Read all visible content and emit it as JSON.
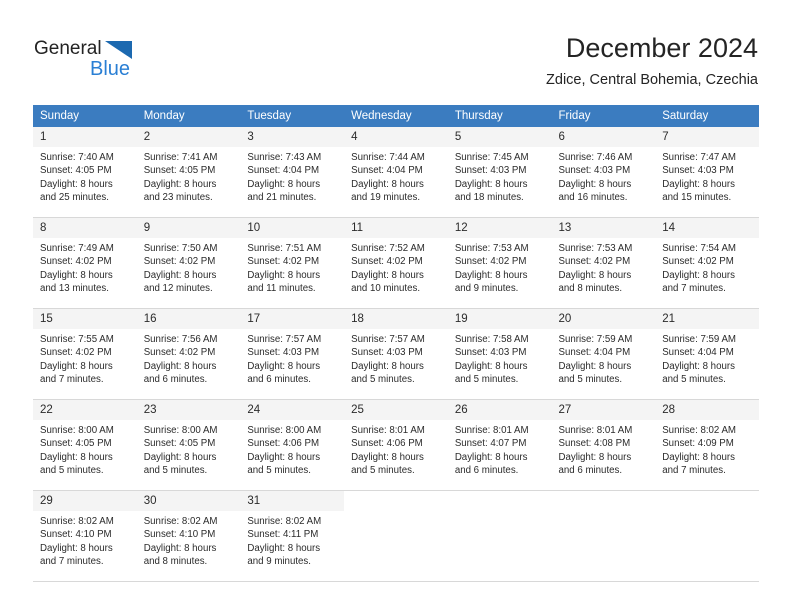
{
  "brand": {
    "name_part1": "General",
    "name_part2": "Blue",
    "accent_color": "#2a7fd4",
    "triangle_color": "#1c69b0"
  },
  "header": {
    "title": "December 2024",
    "subtitle": "Zdice, Central Bohemia, Czechia"
  },
  "calendar": {
    "header_bg": "#3b7cc0",
    "weekday_headers": [
      "Sunday",
      "Monday",
      "Tuesday",
      "Wednesday",
      "Thursday",
      "Friday",
      "Saturday"
    ],
    "weeks": [
      [
        {
          "day": "1",
          "sunrise": "Sunrise: 7:40 AM",
          "sunset": "Sunset: 4:05 PM",
          "daylight_line1": "Daylight: 8 hours",
          "daylight_line2": "and 25 minutes."
        },
        {
          "day": "2",
          "sunrise": "Sunrise: 7:41 AM",
          "sunset": "Sunset: 4:05 PM",
          "daylight_line1": "Daylight: 8 hours",
          "daylight_line2": "and 23 minutes."
        },
        {
          "day": "3",
          "sunrise": "Sunrise: 7:43 AM",
          "sunset": "Sunset: 4:04 PM",
          "daylight_line1": "Daylight: 8 hours",
          "daylight_line2": "and 21 minutes."
        },
        {
          "day": "4",
          "sunrise": "Sunrise: 7:44 AM",
          "sunset": "Sunset: 4:04 PM",
          "daylight_line1": "Daylight: 8 hours",
          "daylight_line2": "and 19 minutes."
        },
        {
          "day": "5",
          "sunrise": "Sunrise: 7:45 AM",
          "sunset": "Sunset: 4:03 PM",
          "daylight_line1": "Daylight: 8 hours",
          "daylight_line2": "and 18 minutes."
        },
        {
          "day": "6",
          "sunrise": "Sunrise: 7:46 AM",
          "sunset": "Sunset: 4:03 PM",
          "daylight_line1": "Daylight: 8 hours",
          "daylight_line2": "and 16 minutes."
        },
        {
          "day": "7",
          "sunrise": "Sunrise: 7:47 AM",
          "sunset": "Sunset: 4:03 PM",
          "daylight_line1": "Daylight: 8 hours",
          "daylight_line2": "and 15 minutes."
        }
      ],
      [
        {
          "day": "8",
          "sunrise": "Sunrise: 7:49 AM",
          "sunset": "Sunset: 4:02 PM",
          "daylight_line1": "Daylight: 8 hours",
          "daylight_line2": "and 13 minutes."
        },
        {
          "day": "9",
          "sunrise": "Sunrise: 7:50 AM",
          "sunset": "Sunset: 4:02 PM",
          "daylight_line1": "Daylight: 8 hours",
          "daylight_line2": "and 12 minutes."
        },
        {
          "day": "10",
          "sunrise": "Sunrise: 7:51 AM",
          "sunset": "Sunset: 4:02 PM",
          "daylight_line1": "Daylight: 8 hours",
          "daylight_line2": "and 11 minutes."
        },
        {
          "day": "11",
          "sunrise": "Sunrise: 7:52 AM",
          "sunset": "Sunset: 4:02 PM",
          "daylight_line1": "Daylight: 8 hours",
          "daylight_line2": "and 10 minutes."
        },
        {
          "day": "12",
          "sunrise": "Sunrise: 7:53 AM",
          "sunset": "Sunset: 4:02 PM",
          "daylight_line1": "Daylight: 8 hours",
          "daylight_line2": "and 9 minutes."
        },
        {
          "day": "13",
          "sunrise": "Sunrise: 7:53 AM",
          "sunset": "Sunset: 4:02 PM",
          "daylight_line1": "Daylight: 8 hours",
          "daylight_line2": "and 8 minutes."
        },
        {
          "day": "14",
          "sunrise": "Sunrise: 7:54 AM",
          "sunset": "Sunset: 4:02 PM",
          "daylight_line1": "Daylight: 8 hours",
          "daylight_line2": "and 7 minutes."
        }
      ],
      [
        {
          "day": "15",
          "sunrise": "Sunrise: 7:55 AM",
          "sunset": "Sunset: 4:02 PM",
          "daylight_line1": "Daylight: 8 hours",
          "daylight_line2": "and 7 minutes."
        },
        {
          "day": "16",
          "sunrise": "Sunrise: 7:56 AM",
          "sunset": "Sunset: 4:02 PM",
          "daylight_line1": "Daylight: 8 hours",
          "daylight_line2": "and 6 minutes."
        },
        {
          "day": "17",
          "sunrise": "Sunrise: 7:57 AM",
          "sunset": "Sunset: 4:03 PM",
          "daylight_line1": "Daylight: 8 hours",
          "daylight_line2": "and 6 minutes."
        },
        {
          "day": "18",
          "sunrise": "Sunrise: 7:57 AM",
          "sunset": "Sunset: 4:03 PM",
          "daylight_line1": "Daylight: 8 hours",
          "daylight_line2": "and 5 minutes."
        },
        {
          "day": "19",
          "sunrise": "Sunrise: 7:58 AM",
          "sunset": "Sunset: 4:03 PM",
          "daylight_line1": "Daylight: 8 hours",
          "daylight_line2": "and 5 minutes."
        },
        {
          "day": "20",
          "sunrise": "Sunrise: 7:59 AM",
          "sunset": "Sunset: 4:04 PM",
          "daylight_line1": "Daylight: 8 hours",
          "daylight_line2": "and 5 minutes."
        },
        {
          "day": "21",
          "sunrise": "Sunrise: 7:59 AM",
          "sunset": "Sunset: 4:04 PM",
          "daylight_line1": "Daylight: 8 hours",
          "daylight_line2": "and 5 minutes."
        }
      ],
      [
        {
          "day": "22",
          "sunrise": "Sunrise: 8:00 AM",
          "sunset": "Sunset: 4:05 PM",
          "daylight_line1": "Daylight: 8 hours",
          "daylight_line2": "and 5 minutes."
        },
        {
          "day": "23",
          "sunrise": "Sunrise: 8:00 AM",
          "sunset": "Sunset: 4:05 PM",
          "daylight_line1": "Daylight: 8 hours",
          "daylight_line2": "and 5 minutes."
        },
        {
          "day": "24",
          "sunrise": "Sunrise: 8:00 AM",
          "sunset": "Sunset: 4:06 PM",
          "daylight_line1": "Daylight: 8 hours",
          "daylight_line2": "and 5 minutes."
        },
        {
          "day": "25",
          "sunrise": "Sunrise: 8:01 AM",
          "sunset": "Sunset: 4:06 PM",
          "daylight_line1": "Daylight: 8 hours",
          "daylight_line2": "and 5 minutes."
        },
        {
          "day": "26",
          "sunrise": "Sunrise: 8:01 AM",
          "sunset": "Sunset: 4:07 PM",
          "daylight_line1": "Daylight: 8 hours",
          "daylight_line2": "and 6 minutes."
        },
        {
          "day": "27",
          "sunrise": "Sunrise: 8:01 AM",
          "sunset": "Sunset: 4:08 PM",
          "daylight_line1": "Daylight: 8 hours",
          "daylight_line2": "and 6 minutes."
        },
        {
          "day": "28",
          "sunrise": "Sunrise: 8:02 AM",
          "sunset": "Sunset: 4:09 PM",
          "daylight_line1": "Daylight: 8 hours",
          "daylight_line2": "and 7 minutes."
        }
      ],
      [
        {
          "day": "29",
          "sunrise": "Sunrise: 8:02 AM",
          "sunset": "Sunset: 4:10 PM",
          "daylight_line1": "Daylight: 8 hours",
          "daylight_line2": "and 7 minutes."
        },
        {
          "day": "30",
          "sunrise": "Sunrise: 8:02 AM",
          "sunset": "Sunset: 4:10 PM",
          "daylight_line1": "Daylight: 8 hours",
          "daylight_line2": "and 8 minutes."
        },
        {
          "day": "31",
          "sunrise": "Sunrise: 8:02 AM",
          "sunset": "Sunset: 4:11 PM",
          "daylight_line1": "Daylight: 8 hours",
          "daylight_line2": "and 9 minutes."
        },
        {
          "day": "",
          "sunrise": "",
          "sunset": "",
          "daylight_line1": "",
          "daylight_line2": ""
        },
        {
          "day": "",
          "sunrise": "",
          "sunset": "",
          "daylight_line1": "",
          "daylight_line2": ""
        },
        {
          "day": "",
          "sunrise": "",
          "sunset": "",
          "daylight_line1": "",
          "daylight_line2": ""
        },
        {
          "day": "",
          "sunrise": "",
          "sunset": "",
          "daylight_line1": "",
          "daylight_line2": ""
        }
      ]
    ]
  }
}
